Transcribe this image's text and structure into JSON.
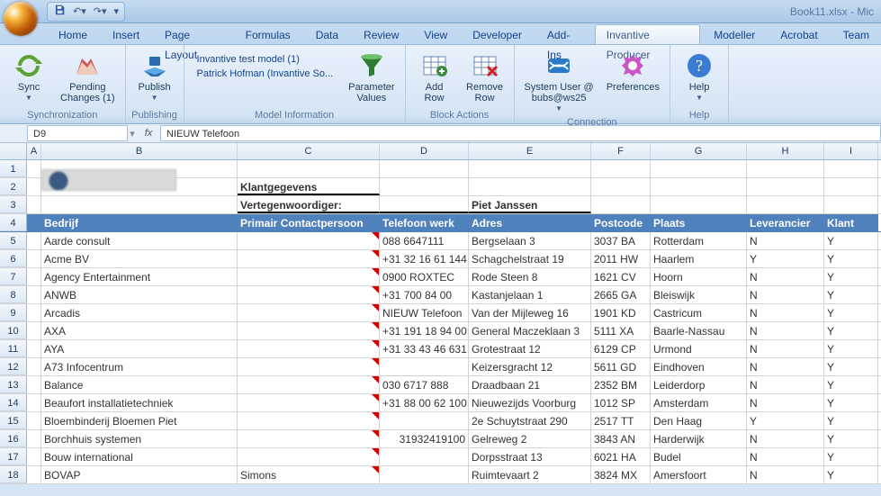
{
  "window": {
    "filename": "Book11.xlsx - Mic"
  },
  "ribbon": {
    "tabs": [
      "Home",
      "Insert",
      "Page Layout",
      "Formulas",
      "Data",
      "Review",
      "View",
      "Developer",
      "Add-Ins",
      "Invantive Producer",
      "Modeller",
      "Acrobat",
      "Team"
    ],
    "active_tab_index": 9,
    "groups": {
      "sync": {
        "label": "Synchronization",
        "sync_btn": "Sync",
        "pending_btn": "Pending\nChanges (1)"
      },
      "publish": {
        "label": "Publishing",
        "publish_btn": "Publish"
      },
      "modelinfo": {
        "label": "Model Information",
        "line1": "Invantive test model (1)",
        "line2": "Patrick Hofman (Invantive So...",
        "param_btn": "Parameter\nValues"
      },
      "block": {
        "label": "Block Actions",
        "add_btn": "Add\nRow",
        "remove_btn": "Remove\nRow"
      },
      "conn": {
        "label": "Connection",
        "user_btn": "System User @\nbubs@ws25",
        "pref_btn": "Preferences"
      },
      "help": {
        "label": "Help",
        "help_btn": "Help"
      }
    }
  },
  "formula_bar": {
    "name_box": "D9",
    "formula": "NIEUW Telefoon"
  },
  "sheet": {
    "columns": [
      "A",
      "B",
      "C",
      "D",
      "E",
      "F",
      "G",
      "H",
      "I"
    ],
    "first_headers": {
      "klantgegevens": "Klantgegevens",
      "vertegenwoordiger_label": "Vertegenwoordiger:",
      "vertegenwoordiger_value": "Piet Janssen"
    },
    "column_headers": [
      "Bedrijf",
      "Primair Contactpersoon",
      "Telefoon werk",
      "Adres",
      "Postcode",
      "Plaats",
      "Leverancier",
      "Klant"
    ],
    "rows": [
      {
        "r": 5,
        "bedrijf": "Aarde consult",
        "contact": "",
        "tel": "088 6647111",
        "adres": "Bergselaan 3",
        "pc": "3037 BA",
        "plaats": "Rotterdam",
        "lev": "N",
        "klant": "Y"
      },
      {
        "r": 6,
        "bedrijf": "Acme BV",
        "contact": "",
        "tel": "+31 32 16 61 144",
        "adres": "Schagchelstraat 19",
        "pc": "2011 HW",
        "plaats": "Haarlem",
        "lev": "Y",
        "klant": "Y"
      },
      {
        "r": 7,
        "bedrijf": "Agency Entertainment",
        "contact": "",
        "tel": "0900 ROXTEC",
        "adres": "Rode Steen 8",
        "pc": "1621 CV",
        "plaats": "Hoorn",
        "lev": "N",
        "klant": "Y"
      },
      {
        "r": 8,
        "bedrijf": "ANWB",
        "contact": "",
        "tel": "+31 700 84 00",
        "adres": "Kastanjelaan 1",
        "pc": "2665 GA",
        "plaats": "Bleiswijk",
        "lev": "N",
        "klant": "Y"
      },
      {
        "r": 9,
        "bedrijf": "Arcadis",
        "contact": "",
        "tel": "NIEUW Telefoon",
        "adres": "Van der Mijleweg 16",
        "pc": "1901 KD",
        "plaats": "Castricum",
        "lev": "N",
        "klant": "Y"
      },
      {
        "r": 10,
        "bedrijf": "AXA",
        "contact": "",
        "tel": "+31 191 18 94 00",
        "adres": "General Maczeklaan 3",
        "pc": "5111 XA",
        "plaats": "Baarle-Nassau",
        "lev": "N",
        "klant": "Y"
      },
      {
        "r": 11,
        "bedrijf": "AYA",
        "contact": "",
        "tel": "+31 33 43 46 631",
        "adres": "Grotestraat 12",
        "pc": "6129 CP",
        "plaats": "Urmond",
        "lev": "N",
        "klant": "Y"
      },
      {
        "r": 12,
        "bedrijf": "A73 Infocentrum",
        "contact": "",
        "tel": "",
        "adres": "Keizersgracht 12",
        "pc": "5611 GD",
        "plaats": "Eindhoven",
        "lev": "N",
        "klant": "Y"
      },
      {
        "r": 13,
        "bedrijf": "Balance",
        "contact": "",
        "tel": "030 6717 888",
        "adres": "Draadbaan 21",
        "pc": "2352 BM",
        "plaats": "Leiderdorp",
        "lev": "N",
        "klant": "Y"
      },
      {
        "r": 14,
        "bedrijf": "Beaufort installatietechniek",
        "contact": "",
        "tel": "+31 88 00 62 100",
        "adres": "Nieuwezijds Voorburg",
        "pc": "1012 SP",
        "plaats": "Amsterdam",
        "lev": "N",
        "klant": "Y"
      },
      {
        "r": 15,
        "bedrijf": "Bloembinderij Bloemen Piet",
        "contact": "",
        "tel": "",
        "adres": "2e Schuytstraat 290",
        "pc": "2517 TT",
        "plaats": "Den Haag",
        "lev": "Y",
        "klant": "Y"
      },
      {
        "r": 16,
        "bedrijf": "Borchhuis systemen",
        "contact": "",
        "tel": "31932419100",
        "adres": "Gelreweg 2",
        "pc": "3843 AN",
        "plaats": "Harderwijk",
        "lev": "N",
        "klant": "Y",
        "tel_right": true
      },
      {
        "r": 17,
        "bedrijf": "Bouw international",
        "contact": "",
        "tel": "",
        "adres": "Dorpsstraat 13",
        "pc": "6021 HA",
        "plaats": "Budel",
        "lev": "N",
        "klant": "Y"
      },
      {
        "r": 18,
        "bedrijf": "BOVAP",
        "contact": "Simons",
        "tel": "",
        "adres": "Ruimtevaart 2",
        "pc": "3824 MX",
        "plaats": "Amersfoort",
        "lev": "N",
        "klant": "Y"
      }
    ]
  }
}
